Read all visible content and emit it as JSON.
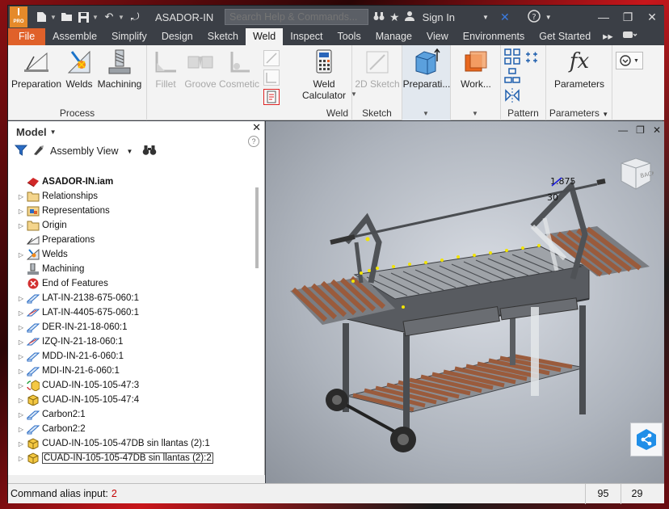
{
  "titlebar": {
    "app_badge": "I",
    "app_badge_sub": "PRO",
    "document": "ASADOR-IN",
    "search_placeholder": "Search Help & Commands...",
    "sign_in": "Sign In"
  },
  "ribbon_tabs": [
    "File",
    "Assemble",
    "Simplify",
    "Design",
    "Sketch",
    "Weld",
    "Inspect",
    "Tools",
    "Manage",
    "View",
    "Environments",
    "Get Started"
  ],
  "active_tab": "Weld",
  "ribbon": {
    "process": {
      "label": "Process",
      "preparation": "Preparation",
      "welds": "Welds",
      "machining": "Machining"
    },
    "weld": {
      "label": "Weld",
      "fillet": "Fillet",
      "groove": "Groove",
      "cosmetic": "Cosmetic",
      "calculator_line1": "Weld",
      "calculator_line2": "Calculator"
    },
    "sketch": {
      "label": "Sketch",
      "sketch2d": "2D Sketch"
    },
    "preparation_split": "Preparati...",
    "work_split": "Work...",
    "pattern": {
      "label": "Pattern"
    },
    "parameters": {
      "label": "Parameters",
      "button": "Parameters",
      "symbol": "fx"
    }
  },
  "browser": {
    "title": "Model",
    "view_label": "Assembly View",
    "items": [
      {
        "label": "ASADOR-IN.iam",
        "icon": "assembly-icon",
        "expand": false,
        "root": true
      },
      {
        "label": "Relationships",
        "icon": "folder-icon",
        "expand": true
      },
      {
        "label": "Representations",
        "icon": "representations-icon",
        "expand": true
      },
      {
        "label": "Origin",
        "icon": "folder-icon",
        "expand": true
      },
      {
        "label": "Preparations",
        "icon": "preparations-icon",
        "expand": false
      },
      {
        "label": "Welds",
        "icon": "welds-icon",
        "expand": true
      },
      {
        "label": "Machining",
        "icon": "machining-icon",
        "expand": false
      },
      {
        "label": "End of Features",
        "icon": "end-of-features-icon",
        "expand": false
      },
      {
        "label": "LAT-IN-2138-675-060:1",
        "icon": "frame-part-icon",
        "expand": true
      },
      {
        "label": "LAT-IN-4405-675-060:1",
        "icon": "frame-part-alt-icon",
        "expand": true
      },
      {
        "label": "DER-IN-21-18-060:1",
        "icon": "frame-part-icon",
        "expand": true
      },
      {
        "label": "IZQ-IN-21-18-060:1",
        "icon": "frame-part-alt-icon",
        "expand": true
      },
      {
        "label": "MDD-IN-21-6-060:1",
        "icon": "frame-part-icon",
        "expand": true
      },
      {
        "label": "MDI-IN-21-6-060:1",
        "icon": "frame-part-icon",
        "expand": true
      },
      {
        "label": "CUAD-IN-105-105-47:3",
        "icon": "cube-pattern-icon",
        "expand": true
      },
      {
        "label": "CUAD-IN-105-105-47:4",
        "icon": "cube-icon",
        "expand": true
      },
      {
        "label": "Carbon2:1",
        "icon": "frame-part-icon",
        "expand": true
      },
      {
        "label": "Carbon2:2",
        "icon": "frame-part-icon",
        "expand": true
      },
      {
        "label": "CUAD-IN-105-105-47DB sin llantas (2):1",
        "icon": "cube-icon",
        "expand": true
      },
      {
        "label": "CUAD-IN-105-105-47DB sin llantas (2):2",
        "icon": "cube-icon",
        "expand": true,
        "selected": true
      }
    ]
  },
  "viewport": {
    "viewcube_face": "BACK",
    "dim_1": "1.875",
    "dim_2": "30"
  },
  "status": {
    "command_label": "Command alias input:",
    "command_value": "2",
    "count_1": "95",
    "count_2": "29"
  },
  "colors": {
    "file_tab": "#e0612a",
    "chrome_dark": "#3b3f46",
    "wood": "#9a5b3c",
    "steel": "#55585c",
    "weld_bead": "#f2e400"
  }
}
